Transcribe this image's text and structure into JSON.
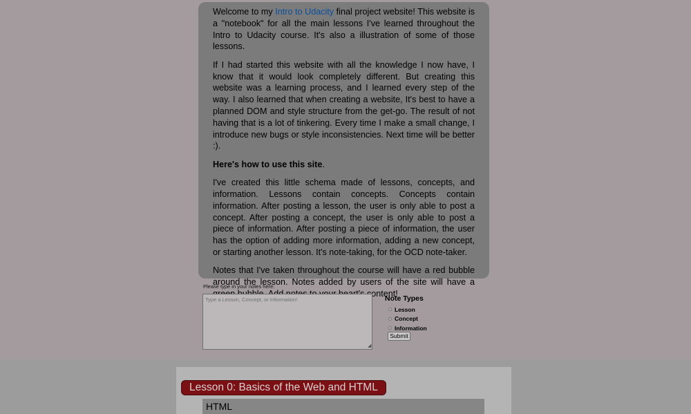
{
  "intro": {
    "p1_before": "Welcome to my ",
    "p1_link": "Intro to Udacity",
    "p1_after": " final project website! This website is a \"notebook\" for all the main lessons I've learned throughout the Intro to Udacity course. It's also a illustration of some of those lessons.",
    "p2": "If I had started this website with all the knowledge I now have, I know that it would look completely different. But creating this website was a learning process, and I learned every step of the way. I also learned that when creating a website, It's best to have a planned DOM and style structure from the get-go. The result of not having that is a lot of tinkering. Every time I make a small change, I introduce new bugs or style inconsistencies. Next time will be better :).",
    "p3_bold": "Here's how to use this site",
    "p3_after": ".",
    "p4": "I've created this little schema made of lessons, concepts, and information. Lessons contain concepts. Concepts contain information. After posting a lesson, the user is only able to post a concept. After posting a concept, the user is only able to post a piece of information. After posting a piece of information, the user has the option of adding more information, adding a new concept, or starting another lesson. It's note-taking, for the OCD note-taker.",
    "p5": "Notes that I've taken throughout the course will have a red bubble around the lesson. Notes added by users of the site will have a green bubble. Add notes to your heart's content!"
  },
  "form": {
    "label": "Please type in your notes here:",
    "placeholder": "Type a Lesson, Concept, or Information!",
    "note_types_title": "Note Types",
    "options": [
      "Lesson",
      "Concept",
      "Information"
    ],
    "submit_label": "Submit"
  },
  "notes": {
    "lesson_title": "Lesson 0: Basics of the Web and HTML",
    "concept_title": "HTML"
  },
  "colors": {
    "page_bg": "#a39b9d",
    "intro_bg": "#7b7b7b",
    "link": "#0a4f9c",
    "lesson_bubble": "#7a0f14"
  }
}
